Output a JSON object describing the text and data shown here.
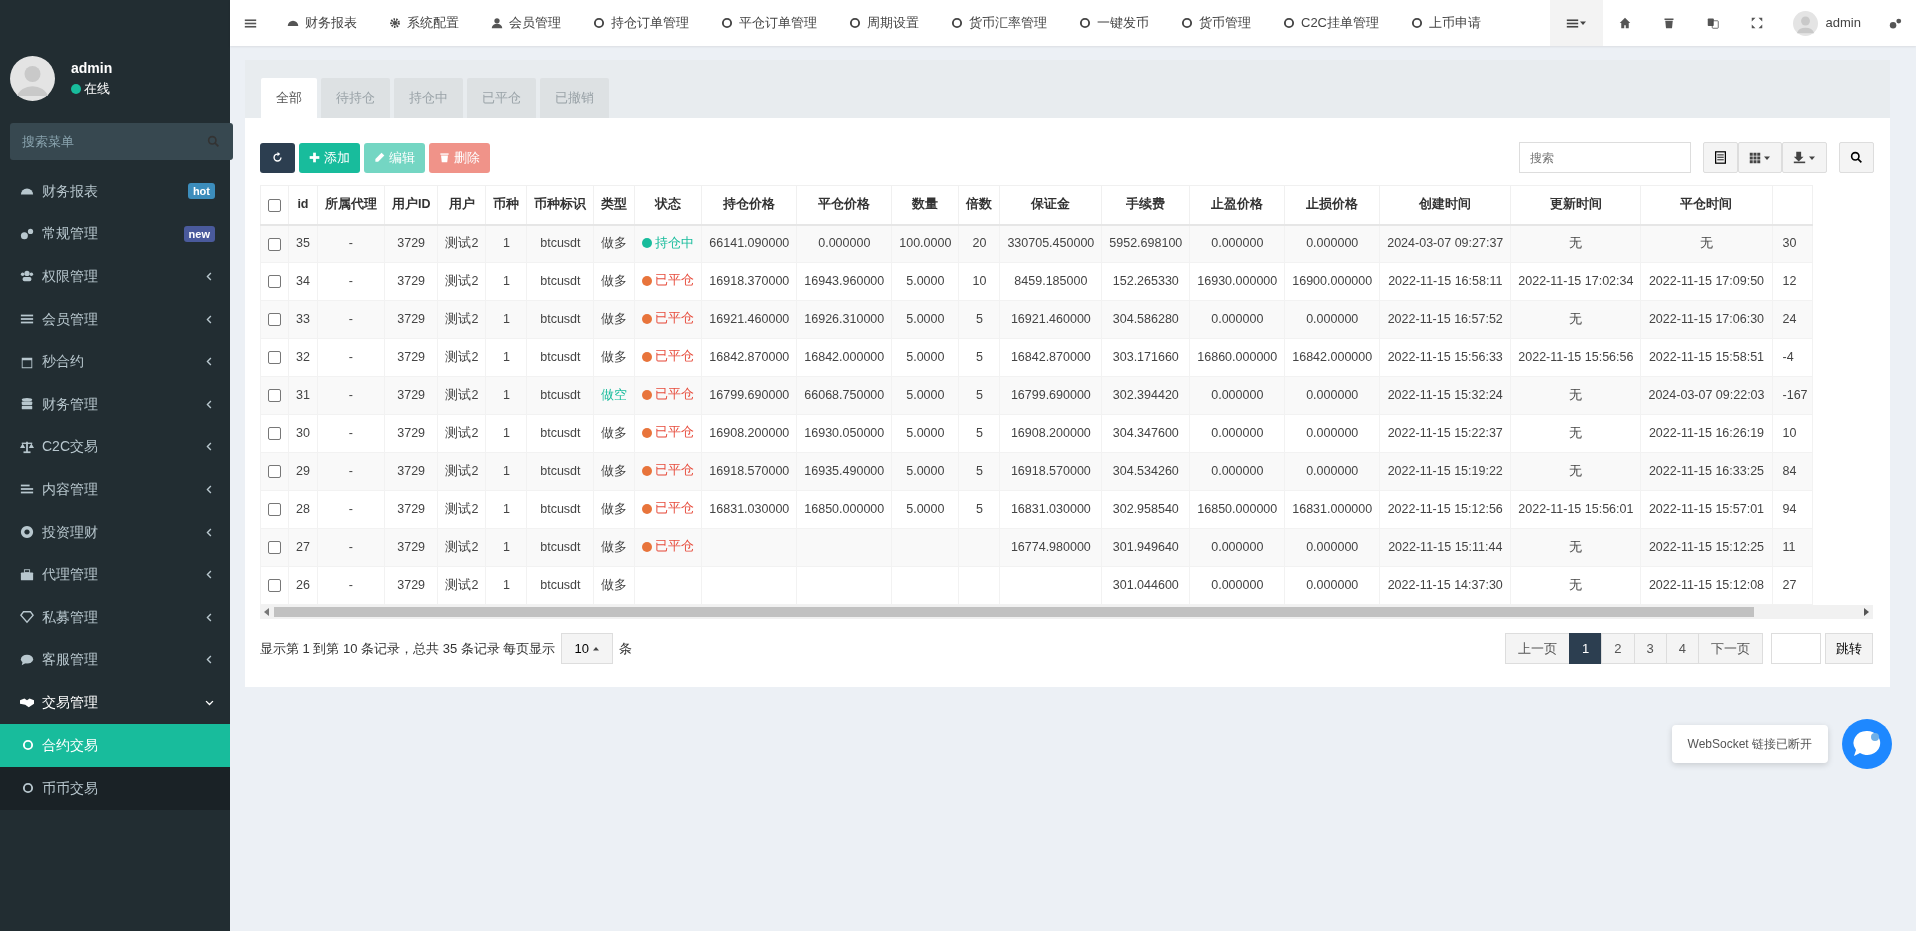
{
  "user_panel": {
    "name": "admin",
    "status": "在线",
    "online": true
  },
  "sidebar": {
    "search": {
      "placeholder": "搜索菜单"
    },
    "items": [
      {
        "label": "财务报表",
        "badge": {
          "text": "hot",
          "color": "#3c8dbc"
        }
      },
      {
        "label": "常规管理",
        "badge": {
          "text": "new",
          "color": "#4a5a9c"
        }
      },
      {
        "label": "权限管理",
        "expanded": false
      },
      {
        "label": "会员管理",
        "expanded": false
      },
      {
        "label": "秒合约",
        "expanded": false
      },
      {
        "label": "财务管理",
        "expanded": false
      },
      {
        "label": "C2C交易",
        "expanded": false
      },
      {
        "label": "内容管理",
        "expanded": false
      },
      {
        "label": "投资理财",
        "expanded": false
      },
      {
        "label": "代理管理",
        "expanded": false
      },
      {
        "label": "私募管理",
        "expanded": false
      },
      {
        "label": "客服管理",
        "expanded": false
      },
      {
        "label": "交易管理",
        "expanded": true,
        "children": [
          {
            "label": "合约交易",
            "selected": true
          },
          {
            "label": "币币交易",
            "selected": false
          }
        ]
      }
    ]
  },
  "top_nav": {
    "items": [
      "财务报表",
      "系统配置",
      "会员管理",
      "持仓订单管理",
      "平仓订单管理",
      "周期设置",
      "货币汇率管理",
      "一键发币",
      "货币管理",
      "C2C挂单管理",
      "上币申请"
    ],
    "user": "admin"
  },
  "tabs": [
    {
      "label": "全部",
      "selected": true
    },
    {
      "label": "待持仓",
      "selected": false
    },
    {
      "label": "持仓中",
      "selected": false
    },
    {
      "label": "已平仓",
      "selected": false
    },
    {
      "label": "已撤销",
      "selected": false
    }
  ],
  "toolbar": {
    "buttons": [
      {
        "kind": "refresh",
        "disabled": false
      },
      {
        "kind": "add",
        "label": "添加",
        "disabled": false
      },
      {
        "kind": "edit",
        "label": "编辑",
        "disabled": true
      },
      {
        "kind": "delete",
        "label": "删除",
        "disabled": true
      }
    ],
    "search": {
      "placeholder": "搜索"
    }
  },
  "table": {
    "header_checked": false,
    "columns": [
      "id",
      "所属代理",
      "用户ID",
      "用户",
      "币种",
      "币种标识",
      "类型",
      "状态",
      "持仓价格",
      "平仓价格",
      "数量",
      "倍数",
      "保证金",
      "手续费",
      "止盈价格",
      "止损价格",
      "创建时间",
      "更新时间",
      "平仓时间"
    ],
    "rows": [
      {
        "checked": false,
        "cells": [
          "35",
          "-",
          "3729",
          "测试2",
          "1",
          "btcusdt",
          {
            "text": "做多",
            "kind": "long"
          },
          {
            "text": "持仓中",
            "color": "#18bc9c"
          },
          "66141.090000",
          "0.000000",
          "100.0000",
          "20",
          "330705.450000",
          "5952.698100",
          "0.000000",
          "0.000000",
          "2024-03-07 09:27:37",
          "无",
          "无",
          "30"
        ]
      },
      {
        "checked": false,
        "cells": [
          "34",
          "-",
          "3729",
          "测试2",
          "1",
          "btcusdt",
          {
            "text": "做多",
            "kind": "long"
          },
          {
            "text": "已平仓",
            "color": "#e8743b"
          },
          "16918.370000",
          "16943.960000",
          "5.0000",
          "10",
          "8459.185000",
          "152.265330",
          "16930.000000",
          "16900.000000",
          "2022-11-15 16:58:11",
          "2022-11-15 17:02:34",
          "2022-11-15 17:09:50",
          "12"
        ]
      },
      {
        "checked": false,
        "cells": [
          "33",
          "-",
          "3729",
          "测试2",
          "1",
          "btcusdt",
          {
            "text": "做多",
            "kind": "long"
          },
          {
            "text": "已平仓",
            "color": "#e8743b"
          },
          "16921.460000",
          "16926.310000",
          "5.0000",
          "5",
          "16921.460000",
          "304.586280",
          "0.000000",
          "0.000000",
          "2022-11-15 16:57:52",
          "无",
          "2022-11-15 17:06:30",
          "24"
        ]
      },
      {
        "checked": false,
        "cells": [
          "32",
          "-",
          "3729",
          "测试2",
          "1",
          "btcusdt",
          {
            "text": "做多",
            "kind": "long"
          },
          {
            "text": "已平仓",
            "color": "#e8743b"
          },
          "16842.870000",
          "16842.000000",
          "5.0000",
          "5",
          "16842.870000",
          "303.171660",
          "16860.000000",
          "16842.000000",
          "2022-11-15 15:56:33",
          "2022-11-15 15:56:56",
          "2022-11-15 15:58:51",
          "-4"
        ]
      },
      {
        "checked": false,
        "cells": [
          "31",
          "-",
          "3729",
          "测试2",
          "1",
          "btcusdt",
          {
            "text": "做空",
            "kind": "short"
          },
          {
            "text": "已平仓",
            "color": "#e8743b"
          },
          "16799.690000",
          "66068.750000",
          "5.0000",
          "5",
          "16799.690000",
          "302.394420",
          "0.000000",
          "0.000000",
          "2022-11-15 15:32:24",
          "无",
          "2024-03-07 09:22:03",
          "-167"
        ]
      },
      {
        "checked": false,
        "cells": [
          "30",
          "-",
          "3729",
          "测试2",
          "1",
          "btcusdt",
          {
            "text": "做多",
            "kind": "long"
          },
          {
            "text": "已平仓",
            "color": "#e8743b"
          },
          "16908.200000",
          "16930.050000",
          "5.0000",
          "5",
          "16908.200000",
          "304.347600",
          "0.000000",
          "0.000000",
          "2022-11-15 15:22:37",
          "无",
          "2022-11-15 16:26:19",
          "10"
        ]
      },
      {
        "checked": false,
        "cells": [
          "29",
          "-",
          "3729",
          "测试2",
          "1",
          "btcusdt",
          {
            "text": "做多",
            "kind": "long"
          },
          {
            "text": "已平仓",
            "color": "#e8743b"
          },
          "16918.570000",
          "16935.490000",
          "5.0000",
          "5",
          "16918.570000",
          "304.534260",
          "0.000000",
          "0.000000",
          "2022-11-15 15:19:22",
          "无",
          "2022-11-15 16:33:25",
          "84"
        ]
      },
      {
        "checked": false,
        "cells": [
          "28",
          "-",
          "3729",
          "测试2",
          "1",
          "btcusdt",
          {
            "text": "做多",
            "kind": "long"
          },
          {
            "text": "已平仓",
            "color": "#e8743b"
          },
          "16831.030000",
          "16850.000000",
          "5.0000",
          "5",
          "16831.030000",
          "302.958540",
          "16850.000000",
          "16831.000000",
          "2022-11-15 15:12:56",
          "2022-11-15 15:56:01",
          "2022-11-15 15:57:01",
          "94"
        ]
      },
      {
        "checked": false,
        "cells": [
          "27",
          "-",
          "3729",
          "测试2",
          "1",
          "btcusdt",
          {
            "text": "做多",
            "kind": "long"
          },
          {
            "text": "已平仓",
            "color": "#e8743b"
          },
          null,
          null,
          null,
          null,
          "16774.980000",
          "301.949640",
          "0.000000",
          "0.000000",
          "2022-11-15 15:11:44",
          "无",
          "2022-11-15 15:12:25",
          "11"
        ]
      },
      {
        "checked": false,
        "cells": [
          "26",
          "-",
          "3729",
          "测试2",
          "1",
          "btcusdt",
          {
            "text": "做多",
            "kind": "long"
          },
          null,
          null,
          null,
          null,
          null,
          null,
          "301.044600",
          "0.000000",
          "0.000000",
          "2022-11-15 14:37:30",
          "无",
          "2022-11-15 15:12:08",
          "27"
        ]
      }
    ]
  },
  "footer": {
    "summary": "显示第 1 到第 10 条记录，总共 35 条记录 每页显示",
    "page_size": "10",
    "suffix": "条"
  },
  "pagination": {
    "prev": "上一页",
    "pages": [
      {
        "label": "1",
        "selected": true
      },
      {
        "label": "2",
        "selected": false
      },
      {
        "label": "3",
        "selected": false
      },
      {
        "label": "4",
        "selected": false
      }
    ],
    "next": "下一页",
    "jump": "跳转"
  },
  "websocket": {
    "message": "WebSocket 链接已断开"
  }
}
